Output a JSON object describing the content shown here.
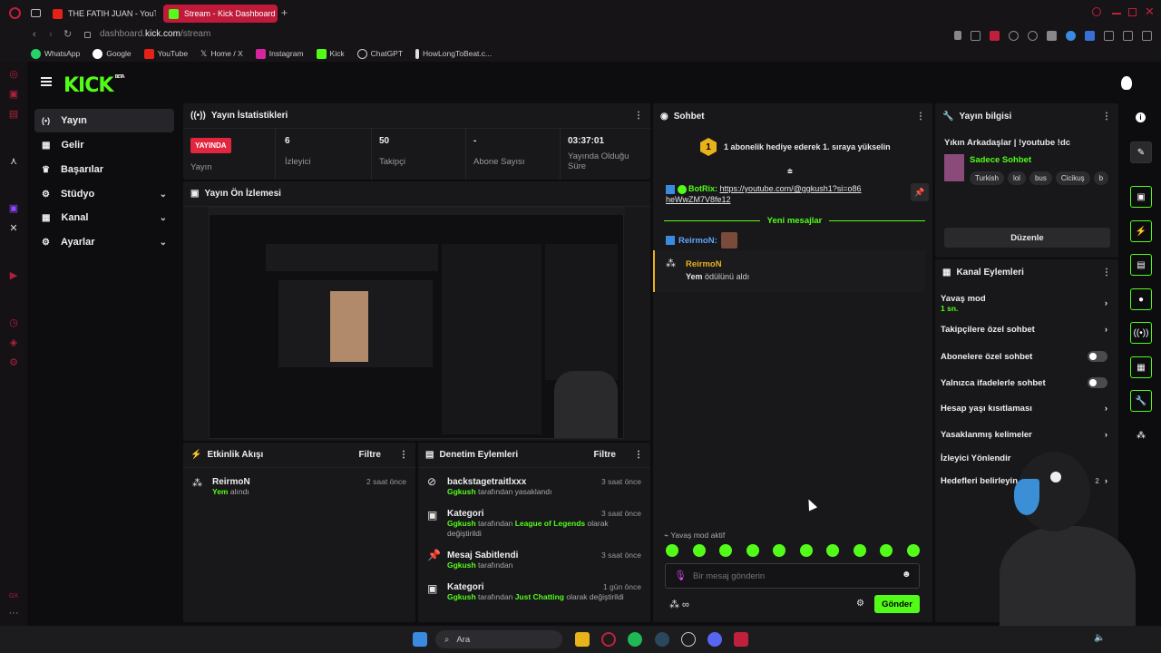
{
  "browser": {
    "tabs": [
      {
        "label": "THE FATIH JUAN - YouTu",
        "favicon": "youtube-icon"
      },
      {
        "label": "Stream - Kick Dashboard",
        "favicon": "kick-icon"
      }
    ],
    "url_prefix": "dashboard.",
    "url_domain": "kick.com",
    "url_path": "/stream",
    "bookmarks": [
      "WhatsApp",
      "Google",
      "YouTube",
      "Home / X",
      "Instagram",
      "Kick",
      "ChatGPT",
      "HowLongToBeat.c..."
    ]
  },
  "brand": {
    "logo": "KICK",
    "beta": "BETA",
    "accent": "#53fc18"
  },
  "nav": {
    "items": [
      {
        "label": "Yayın",
        "icon": "stream-icon"
      },
      {
        "label": "Gelir",
        "icon": "revenue-icon"
      },
      {
        "label": "Başarılar",
        "icon": "trophy-icon"
      },
      {
        "label": "Stüdyo",
        "icon": "studio-icon"
      },
      {
        "label": "Kanal",
        "icon": "channel-icon"
      },
      {
        "label": "Ayarlar",
        "icon": "settings-icon"
      }
    ]
  },
  "stats": {
    "title": "Yayın İstatistikleri",
    "status": "YAYINDA",
    "status_label": "Yayın",
    "items": [
      {
        "value": "6",
        "label": "İzleyici"
      },
      {
        "value": "50",
        "label": "Takipçi"
      },
      {
        "value": "-",
        "label": "Abone Sayısı"
      },
      {
        "value": "03:37:01",
        "label": "Yayında Olduğu Süre"
      }
    ]
  },
  "preview": {
    "title": "Yayın Ön İzlemesi"
  },
  "activity": {
    "title": "Etkinlik Akışı",
    "filter": "Filtre",
    "items": [
      {
        "user": "ReirmoN",
        "action_hl": "Yem",
        "action": "alındı",
        "time": "2 saat önce"
      }
    ]
  },
  "moderation": {
    "title": "Denetim Eylemleri",
    "filter": "Filtre",
    "items": [
      {
        "title": "backstagetraitlxxx",
        "user": "Ggkush",
        "text": "tarafından yasaklandı",
        "time": "3 saat önce"
      },
      {
        "title": "Kategori",
        "user": "Ggkush",
        "text": "tarafından",
        "hl": "League of Legends",
        "text2": "olarak değiştirildi",
        "time": "3 saat önce"
      },
      {
        "title": "Mesaj Sabitlendi",
        "user": "Ggkush",
        "text": "tarafından",
        "time": "3 saat önce"
      },
      {
        "title": "Kategori",
        "user": "Ggkush",
        "text": "tarafından",
        "hl": "Just Chatting",
        "text2": "olarak değiştirildi",
        "time": "1 gün önce"
      }
    ]
  },
  "chat": {
    "title": "Sohbet",
    "gift_rank": "1",
    "gift_text": "1 abonelik hediye ederek 1. sıraya yükselin",
    "pinned_user": "BotRix:",
    "pinned_link": "https://youtube.com/@ggkush1?si=o86heWwZM7V8fe12",
    "new_messages": "Yeni mesajlar",
    "msg_user": "ReirmoN:",
    "event_user": "ReirmoN",
    "event_hl": "Yem",
    "event_text": "ödülünü aldı",
    "slow_mode": "Yavaş mod aktif",
    "placeholder": "Bir mesaj gönderin",
    "send": "Gönder"
  },
  "info": {
    "title": "Yayın bilgisi",
    "stream_title": "Yıkın Arkadaşlar | !youtube !dc",
    "category": "Sadece Sohbet",
    "tags": [
      "Turkish",
      "lol",
      "bus",
      "Cicikuş",
      "b"
    ],
    "edit": "Düzenle"
  },
  "channel_actions": {
    "title": "Kanal Eylemleri",
    "slow_mode": "Yavaş mod",
    "slow_value": "1 sn.",
    "followers": "Takipçilere özel sohbet",
    "subs": "Abonelere özel sohbet",
    "emotes": "Yalnızca ifadelerle sohbet",
    "age": "Hesap yaşı kısıtlaması",
    "banned": "Yasaklanmış kelimeler",
    "redirect": "İzleyici Yönlendir",
    "goals": "Hedefleri belirleyin",
    "goals_count": "2"
  },
  "taskbar": {
    "search": "Ara"
  }
}
